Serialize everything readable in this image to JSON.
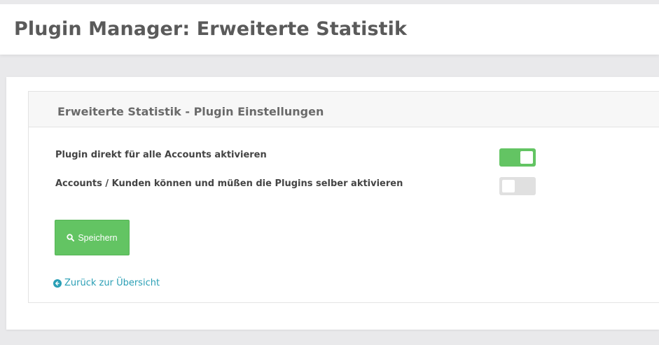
{
  "header": {
    "title": "Plugin Manager: Erweiterte Statistik"
  },
  "panel": {
    "title": "Erweiterte Statistik - Plugin Einstellungen",
    "settings": [
      {
        "label": "Plugin direkt für alle Accounts aktivieren",
        "enabled": true
      },
      {
        "label": "Accounts / Kunden können und müßen die Plugins selber aktivieren",
        "enabled": false
      }
    ],
    "save_label": "Speichern",
    "save_icon": "search-icon",
    "back_label": "Zurück zur Übersicht",
    "back_icon": "arrow-circle-left-icon"
  },
  "colors": {
    "accent_green": "#63c463",
    "link": "#2a9fb5",
    "toggle_off": "#e0e0e0"
  }
}
